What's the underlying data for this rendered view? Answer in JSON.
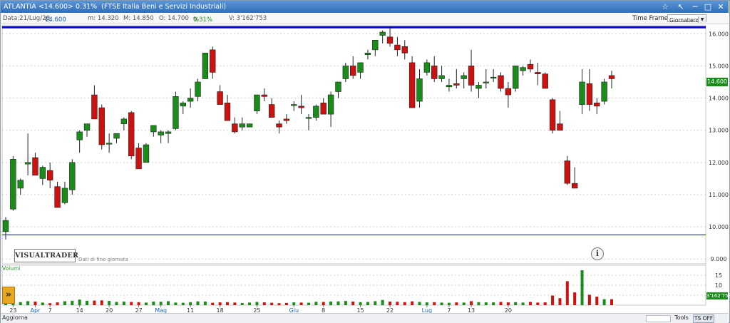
{
  "title": {
    "symbol": "ATLANTIA",
    "price": "<14.600>",
    "change": "0.31%",
    "index": "(FTSE Italia Beni e Servizi Industriali)"
  },
  "window_buttons": [
    "star-icon",
    "arrow-up-left-icon",
    "minimize-icon",
    "maximize-icon",
    "close-icon"
  ],
  "info": {
    "date": "Data:21/Lug/20",
    "close_label": "C:",
    "close": "14.600",
    "min": "m: 14.320",
    "max": "M: 14.850",
    "open": "O: 14.700",
    "pct_label": "%:",
    "pct": "0.31%",
    "volume": "V: 3'162'753"
  },
  "timeframe": {
    "label": "Time Frame",
    "value": "Giornaliero"
  },
  "logo": "VISUALTRADER",
  "eod_note": "Dati di fine giornata",
  "volume_label": "Volumi",
  "current_price_tag": "14.600",
  "volume_tag": "3'162'753",
  "bottom": {
    "aggiorna": "Aggiorna",
    "tools": "Tools",
    "tsoff": "TS OFF"
  },
  "colors": {
    "up": "#1a8c1a",
    "down": "#cc1111",
    "accent": "#2f6fb8",
    "hline": "#0000cc"
  },
  "chart_data": {
    "type": "candlestick",
    "price_axis": {
      "ticks": [
        "16.000",
        "15.000",
        "14.000",
        "13.000",
        "12.000",
        "11.000",
        "10.000",
        "9.000"
      ],
      "range": [
        9,
        16.2
      ]
    },
    "volume_axis": {
      "ticks": [
        "15",
        "10",
        "5"
      ]
    },
    "x_tick_labels": [
      "23",
      "Apr",
      "7",
      "14",
      "20",
      "27",
      "Mag",
      "11",
      "18",
      "25",
      "Giu",
      "8",
      "15",
      "22",
      "Lug",
      "7",
      "13",
      "20"
    ],
    "month_labels": [
      "Apr",
      "Mag",
      "Giu",
      "Lug"
    ],
    "horizontal_lines": [
      16.2,
      9.75
    ],
    "candles": [
      [
        9.85,
        10.3,
        9.6,
        10.2
      ],
      [
        10.55,
        12.2,
        10.5,
        12.1
      ],
      [
        11.2,
        11.5,
        11.0,
        11.45
      ],
      [
        11.95,
        12.9,
        11.6,
        12.0
      ],
      [
        12.15,
        12.3,
        11.7,
        11.6
      ],
      [
        11.5,
        11.9,
        11.3,
        11.85
      ],
      [
        11.75,
        12.0,
        11.2,
        11.45
      ],
      [
        11.25,
        11.4,
        10.6,
        10.6
      ],
      [
        10.75,
        11.4,
        10.7,
        11.2
      ],
      [
        11.15,
        12.1,
        11.0,
        12.0
      ],
      [
        12.7,
        13.0,
        12.3,
        12.95
      ],
      [
        13.0,
        13.2,
        12.8,
        13.2
      ],
      [
        14.1,
        14.4,
        13.4,
        13.35
      ],
      [
        13.7,
        13.8,
        12.4,
        12.55
      ],
      [
        12.6,
        12.9,
        12.3,
        12.6
      ],
      [
        12.75,
        12.9,
        12.6,
        12.9
      ],
      [
        13.2,
        13.4,
        13.0,
        13.35
      ],
      [
        13.55,
        13.6,
        12.1,
        12.2
      ],
      [
        12.45,
        12.6,
        11.8,
        11.8
      ],
      [
        12.0,
        12.6,
        12.0,
        12.55
      ],
      [
        12.95,
        13.1,
        12.8,
        13.15
      ],
      [
        12.85,
        13.0,
        12.6,
        12.95
      ],
      [
        12.9,
        13.0,
        12.6,
        12.95
      ],
      [
        13.05,
        14.2,
        13.0,
        14.05
      ],
      [
        13.75,
        13.9,
        13.5,
        13.85
      ],
      [
        13.9,
        14.3,
        13.7,
        14.0
      ],
      [
        14.05,
        14.6,
        13.9,
        14.5
      ],
      [
        14.6,
        15.2,
        14.6,
        15.4
      ],
      [
        15.5,
        15.6,
        14.6,
        14.8
      ],
      [
        14.2,
        14.4,
        13.9,
        13.8
      ],
      [
        13.85,
        14.1,
        13.3,
        13.3
      ],
      [
        13.2,
        13.4,
        12.9,
        12.95
      ],
      [
        13.1,
        13.4,
        13.0,
        13.2
      ],
      [
        13.1,
        13.2,
        13.1,
        13.2
      ],
      [
        13.6,
        14.0,
        13.5,
        14.1
      ],
      [
        14.1,
        14.3,
        13.9,
        14.05
      ],
      [
        13.8,
        14.0,
        13.4,
        13.4
      ],
      [
        13.2,
        13.3,
        12.9,
        13.1
      ],
      [
        13.35,
        13.5,
        13.2,
        13.3
      ],
      [
        13.8,
        13.9,
        13.6,
        13.8
      ],
      [
        13.75,
        14.1,
        13.5,
        13.7
      ],
      [
        13.4,
        13.5,
        13.0,
        13.4
      ],
      [
        13.4,
        13.8,
        13.3,
        13.75
      ],
      [
        13.85,
        14.0,
        13.5,
        13.5
      ],
      [
        13.5,
        14.2,
        13.1,
        14.1
      ],
      [
        14.2,
        14.4,
        14.0,
        14.5
      ],
      [
        14.6,
        15.1,
        14.5,
        15.0
      ],
      [
        15.0,
        15.3,
        14.6,
        14.7
      ],
      [
        14.8,
        15.1,
        14.6,
        15.1
      ],
      [
        15.35,
        15.5,
        15.2,
        15.4
      ],
      [
        15.5,
        15.8,
        15.3,
        15.8
      ],
      [
        15.95,
        16.1,
        15.7,
        16.05
      ],
      [
        15.9,
        16.2,
        15.6,
        15.7
      ],
      [
        15.65,
        15.9,
        15.3,
        15.5
      ],
      [
        15.6,
        15.8,
        15.2,
        15.4
      ],
      [
        15.1,
        15.3,
        13.8,
        13.7
      ],
      [
        13.9,
        14.9,
        13.7,
        14.6
      ],
      [
        14.8,
        15.2,
        14.7,
        15.1
      ],
      [
        15.0,
        15.3,
        14.5,
        14.6
      ],
      [
        14.6,
        15.0,
        14.5,
        14.7
      ],
      [
        14.35,
        14.6,
        14.2,
        14.4
      ],
      [
        14.45,
        14.9,
        14.3,
        14.4
      ],
      [
        14.6,
        14.8,
        14.3,
        14.7
      ],
      [
        15.0,
        15.5,
        14.2,
        14.4
      ],
      [
        14.3,
        14.5,
        14.0,
        14.4
      ],
      [
        14.5,
        14.9,
        14.3,
        14.5
      ],
      [
        14.65,
        14.9,
        14.5,
        14.65
      ],
      [
        14.7,
        14.8,
        14.2,
        14.3
      ],
      [
        14.3,
        14.5,
        13.7,
        14.1
      ],
      [
        14.3,
        14.9,
        14.2,
        15.0
      ],
      [
        14.85,
        15.0,
        14.7,
        14.95
      ],
      [
        15.05,
        15.2,
        14.8,
        14.9
      ],
      [
        14.8,
        15.1,
        14.4,
        14.75
      ],
      [
        14.75,
        14.8,
        14.3,
        14.3
      ],
      [
        13.95,
        14.0,
        12.9,
        13.0
      ],
      [
        13.2,
        13.6,
        13.0,
        13.0
      ],
      [
        12.05,
        12.2,
        11.3,
        11.35
      ],
      [
        11.35,
        11.85,
        11.2,
        11.2
      ],
      [
        13.8,
        14.9,
        13.5,
        14.5
      ],
      [
        14.45,
        14.9,
        13.6,
        13.8
      ],
      [
        13.85,
        14.0,
        13.5,
        13.75
      ],
      [
        13.9,
        14.6,
        13.8,
        14.5
      ],
      [
        14.7,
        14.85,
        14.3,
        14.6
      ]
    ],
    "volumes": [
      1.8,
      2.0,
      1.5,
      2.0,
      1.8,
      1.3,
      1.0,
      1.4,
      2.0,
      2.2,
      2.8,
      2.2,
      2.3,
      2.4,
      2.1,
      1.6,
      1.8,
      1.6,
      1.5,
      1.3,
      1.8,
      1.7,
      2.0,
      1.3,
      1.2,
      1.5,
      1.9,
      1.8,
      1.2,
      1.4,
      1.5,
      1.3,
      1.1,
      1.3,
      1.6,
      1.4,
      1.2,
      1.0,
      1.1,
      1.4,
      1.3,
      1.2,
      1.7,
      1.6,
      1.8,
      1.9,
      2.1,
      1.8,
      1.5,
      1.6,
      2.0,
      2.6,
      1.8,
      1.7,
      1.5,
      1.9,
      1.6,
      1.4,
      1.5,
      1.3,
      1.2,
      1.4,
      1.3,
      2.0,
      1.5,
      1.4,
      1.4,
      1.6,
      1.4,
      1.5,
      1.3,
      1.6,
      1.3,
      1.4,
      4.8,
      3.5,
      12.0,
      6.4,
      17.5,
      5.2,
      4.3,
      3.0,
      3.0
    ]
  }
}
